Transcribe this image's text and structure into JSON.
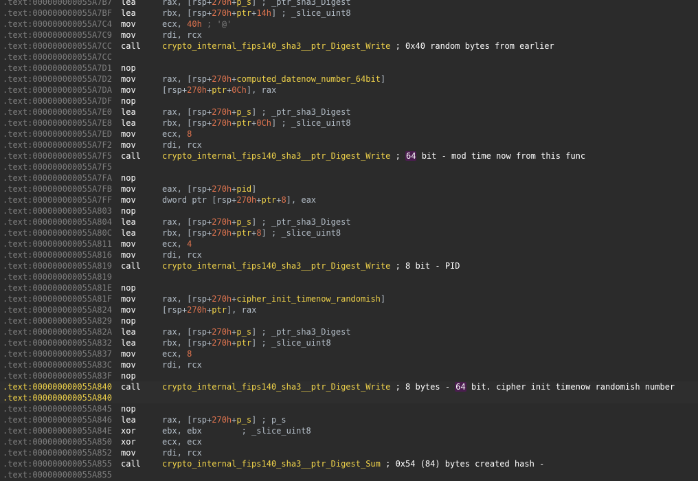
{
  "colors": {
    "background": "#2b2b2b",
    "address": "#7f7f7f",
    "address_highlight": "#f0d34a",
    "mnemonic": "#ffffff",
    "register": "#b4bec8",
    "name": "#f0d34a",
    "number": "#e0744f",
    "highlight_badge": "#4a1d4f"
  },
  "lines": [
    {
      "addr": ".text:000000000055A7B7",
      "mn": "lea",
      "op": [
        {
          "t": "t",
          "v": "rax, ["
        },
        {
          "t": "t",
          "v": "rsp+"
        },
        {
          "t": "num",
          "v": "270h"
        },
        {
          "t": "t",
          "v": "+"
        },
        {
          "t": "var",
          "v": "p_s"
        },
        {
          "t": "t",
          "v": "] ; _ptr_sha3_Digest"
        }
      ]
    },
    {
      "addr": ".text:000000000055A7BF",
      "mn": "lea",
      "op": [
        {
          "t": "t",
          "v": "rbx, [rsp+"
        },
        {
          "t": "num",
          "v": "270h"
        },
        {
          "t": "t",
          "v": "+"
        },
        {
          "t": "var",
          "v": "ptr"
        },
        {
          "t": "t",
          "v": "+"
        },
        {
          "t": "num",
          "v": "14h"
        },
        {
          "t": "t",
          "v": "] ; _slice_uint8"
        }
      ]
    },
    {
      "addr": ".text:000000000055A7C4",
      "mn": "mov",
      "op": [
        {
          "t": "t",
          "v": "ecx, "
        },
        {
          "t": "num",
          "v": "40h"
        },
        {
          "t": "cmtd",
          "v": " ; '@'"
        }
      ]
    },
    {
      "addr": ".text:000000000055A7C9",
      "mn": "mov",
      "op": [
        {
          "t": "t",
          "v": "rdi, rcx"
        }
      ]
    },
    {
      "addr": ".text:000000000055A7CC",
      "mn": "call",
      "op": [
        {
          "t": "fn",
          "v": "crypto_internal_fips140_sha3__ptr_Digest_Write"
        },
        {
          "t": "cmt",
          "v": " ; 0x40 random bytes from earlier"
        }
      ]
    },
    {
      "addr": ".text:000000000055A7CC",
      "mn": "",
      "op": []
    },
    {
      "addr": ".text:000000000055A7D1",
      "mn": "nop",
      "op": []
    },
    {
      "addr": ".text:000000000055A7D2",
      "mn": "mov",
      "op": [
        {
          "t": "t",
          "v": "rax, [rsp+"
        },
        {
          "t": "num",
          "v": "270h"
        },
        {
          "t": "t",
          "v": "+"
        },
        {
          "t": "var",
          "v": "computed_datenow_number_64bit"
        },
        {
          "t": "t",
          "v": "]"
        }
      ]
    },
    {
      "addr": ".text:000000000055A7DA",
      "mn": "mov",
      "op": [
        {
          "t": "t",
          "v": "[rsp+"
        },
        {
          "t": "num",
          "v": "270h"
        },
        {
          "t": "t",
          "v": "+"
        },
        {
          "t": "var",
          "v": "ptr"
        },
        {
          "t": "t",
          "v": "+"
        },
        {
          "t": "num",
          "v": "0Ch"
        },
        {
          "t": "t",
          "v": "], rax"
        }
      ]
    },
    {
      "addr": ".text:000000000055A7DF",
      "mn": "nop",
      "op": []
    },
    {
      "addr": ".text:000000000055A7E0",
      "mn": "lea",
      "op": [
        {
          "t": "t",
          "v": "rax, [rsp+"
        },
        {
          "t": "num",
          "v": "270h"
        },
        {
          "t": "t",
          "v": "+"
        },
        {
          "t": "var",
          "v": "p_s"
        },
        {
          "t": "t",
          "v": "] ; _ptr_sha3_Digest"
        }
      ]
    },
    {
      "addr": ".text:000000000055A7E8",
      "mn": "lea",
      "op": [
        {
          "t": "t",
          "v": "rbx, [rsp+"
        },
        {
          "t": "num",
          "v": "270h"
        },
        {
          "t": "t",
          "v": "+"
        },
        {
          "t": "var",
          "v": "ptr"
        },
        {
          "t": "t",
          "v": "+"
        },
        {
          "t": "num",
          "v": "0Ch"
        },
        {
          "t": "t",
          "v": "] ; _slice_uint8"
        }
      ]
    },
    {
      "addr": ".text:000000000055A7ED",
      "mn": "mov",
      "op": [
        {
          "t": "t",
          "v": "ecx, "
        },
        {
          "t": "num",
          "v": "8"
        }
      ]
    },
    {
      "addr": ".text:000000000055A7F2",
      "mn": "mov",
      "op": [
        {
          "t": "t",
          "v": "rdi, rcx"
        }
      ]
    },
    {
      "addr": ".text:000000000055A7F5",
      "mn": "call",
      "op": [
        {
          "t": "fn",
          "v": "crypto_internal_fips140_sha3__ptr_Digest_Write"
        },
        {
          "t": "cmt",
          "v": " ; "
        },
        {
          "t": "hlnum",
          "v": "64"
        },
        {
          "t": "cmt",
          "v": " bit - mod time now from this func"
        }
      ]
    },
    {
      "addr": ".text:000000000055A7F5",
      "mn": "",
      "op": []
    },
    {
      "addr": ".text:000000000055A7FA",
      "mn": "nop",
      "op": []
    },
    {
      "addr": ".text:000000000055A7FB",
      "mn": "mov",
      "op": [
        {
          "t": "t",
          "v": "eax, [rsp+"
        },
        {
          "t": "num",
          "v": "270h"
        },
        {
          "t": "t",
          "v": "+"
        },
        {
          "t": "var",
          "v": "pid"
        },
        {
          "t": "t",
          "v": "]"
        }
      ]
    },
    {
      "addr": ".text:000000000055A7FF",
      "mn": "mov",
      "op": [
        {
          "t": "t",
          "v": "dword ptr [rsp+"
        },
        {
          "t": "num",
          "v": "270h"
        },
        {
          "t": "t",
          "v": "+"
        },
        {
          "t": "var",
          "v": "ptr"
        },
        {
          "t": "t",
          "v": "+"
        },
        {
          "t": "num",
          "v": "8"
        },
        {
          "t": "t",
          "v": "], eax"
        }
      ]
    },
    {
      "addr": ".text:000000000055A803",
      "mn": "nop",
      "op": []
    },
    {
      "addr": ".text:000000000055A804",
      "mn": "lea",
      "op": [
        {
          "t": "t",
          "v": "rax, [rsp+"
        },
        {
          "t": "num",
          "v": "270h"
        },
        {
          "t": "t",
          "v": "+"
        },
        {
          "t": "var",
          "v": "p_s"
        },
        {
          "t": "t",
          "v": "] ; _ptr_sha3_Digest"
        }
      ]
    },
    {
      "addr": ".text:000000000055A80C",
      "mn": "lea",
      "op": [
        {
          "t": "t",
          "v": "rbx, [rsp+"
        },
        {
          "t": "num",
          "v": "270h"
        },
        {
          "t": "t",
          "v": "+"
        },
        {
          "t": "var",
          "v": "ptr"
        },
        {
          "t": "t",
          "v": "+"
        },
        {
          "t": "num",
          "v": "8"
        },
        {
          "t": "t",
          "v": "] ; _slice_uint8"
        }
      ]
    },
    {
      "addr": ".text:000000000055A811",
      "mn": "mov",
      "op": [
        {
          "t": "t",
          "v": "ecx, "
        },
        {
          "t": "num",
          "v": "4"
        }
      ]
    },
    {
      "addr": ".text:000000000055A816",
      "mn": "mov",
      "op": [
        {
          "t": "t",
          "v": "rdi, rcx"
        }
      ]
    },
    {
      "addr": ".text:000000000055A819",
      "mn": "call",
      "op": [
        {
          "t": "fn",
          "v": "crypto_internal_fips140_sha3__ptr_Digest_Write"
        },
        {
          "t": "cmt",
          "v": " ; 8 bit - PID"
        }
      ]
    },
    {
      "addr": ".text:000000000055A819",
      "mn": "",
      "op": []
    },
    {
      "addr": ".text:000000000055A81E",
      "mn": "nop",
      "op": []
    },
    {
      "addr": ".text:000000000055A81F",
      "mn": "mov",
      "op": [
        {
          "t": "t",
          "v": "rax, [rsp+"
        },
        {
          "t": "num",
          "v": "270h"
        },
        {
          "t": "t",
          "v": "+"
        },
        {
          "t": "var",
          "v": "cipher_init_timenow_randomish"
        },
        {
          "t": "t",
          "v": "]"
        }
      ]
    },
    {
      "addr": ".text:000000000055A824",
      "mn": "mov",
      "op": [
        {
          "t": "t",
          "v": "[rsp+"
        },
        {
          "t": "num",
          "v": "270h"
        },
        {
          "t": "t",
          "v": "+"
        },
        {
          "t": "var",
          "v": "ptr"
        },
        {
          "t": "t",
          "v": "], rax"
        }
      ]
    },
    {
      "addr": ".text:000000000055A829",
      "mn": "nop",
      "op": []
    },
    {
      "addr": ".text:000000000055A82A",
      "mn": "lea",
      "op": [
        {
          "t": "t",
          "v": "rax, [rsp+"
        },
        {
          "t": "num",
          "v": "270h"
        },
        {
          "t": "t",
          "v": "+"
        },
        {
          "t": "var",
          "v": "p_s"
        },
        {
          "t": "t",
          "v": "] ; _ptr_sha3_Digest"
        }
      ]
    },
    {
      "addr": ".text:000000000055A832",
      "mn": "lea",
      "op": [
        {
          "t": "t",
          "v": "rbx, [rsp+"
        },
        {
          "t": "num",
          "v": "270h"
        },
        {
          "t": "t",
          "v": "+"
        },
        {
          "t": "var",
          "v": "ptr"
        },
        {
          "t": "t",
          "v": "] ; _slice_uint8"
        }
      ]
    },
    {
      "addr": ".text:000000000055A837",
      "mn": "mov",
      "op": [
        {
          "t": "t",
          "v": "ecx, "
        },
        {
          "t": "num",
          "v": "8"
        }
      ]
    },
    {
      "addr": ".text:000000000055A83C",
      "mn": "mov",
      "op": [
        {
          "t": "t",
          "v": "rdi, rcx"
        }
      ]
    },
    {
      "addr": ".text:000000000055A83F",
      "mn": "nop",
      "op": []
    },
    {
      "addr": ".text:000000000055A840",
      "mn": "call",
      "hl": true,
      "op": [
        {
          "t": "fn",
          "v": "crypto_internal_fips140_sha3__ptr_Digest_Write"
        },
        {
          "t": "cmt",
          "v": " ; 8 bytes - "
        },
        {
          "t": "hlnum",
          "v": "64"
        },
        {
          "t": "cmt",
          "v": " bit. cipher init timenow randomish number"
        }
      ]
    },
    {
      "addr": ".text:000000000055A840",
      "mn": "",
      "hl": true,
      "op": []
    },
    {
      "addr": ".text:000000000055A845",
      "mn": "nop",
      "op": []
    },
    {
      "addr": ".text:000000000055A846",
      "mn": "lea",
      "op": [
        {
          "t": "t",
          "v": "rax, [rsp+"
        },
        {
          "t": "num",
          "v": "270h"
        },
        {
          "t": "t",
          "v": "+"
        },
        {
          "t": "var",
          "v": "p_s"
        },
        {
          "t": "t",
          "v": "] ; p_s"
        }
      ]
    },
    {
      "addr": ".text:000000000055A84E",
      "mn": "xor",
      "op": [
        {
          "t": "t",
          "v": "ebx, ebx        ; _slice_uint8"
        }
      ]
    },
    {
      "addr": ".text:000000000055A850",
      "mn": "xor",
      "op": [
        {
          "t": "t",
          "v": "ecx, ecx"
        }
      ]
    },
    {
      "addr": ".text:000000000055A852",
      "mn": "mov",
      "op": [
        {
          "t": "t",
          "v": "rdi, rcx"
        }
      ]
    },
    {
      "addr": ".text:000000000055A855",
      "mn": "call",
      "op": [
        {
          "t": "fn",
          "v": "crypto_internal_fips140_sha3__ptr_Digest_Sum"
        },
        {
          "t": "cmt",
          "v": " ; 0x54 (84) bytes created hash -"
        }
      ]
    },
    {
      "addr": ".text:000000000055A855",
      "mn": "",
      "op": []
    }
  ]
}
